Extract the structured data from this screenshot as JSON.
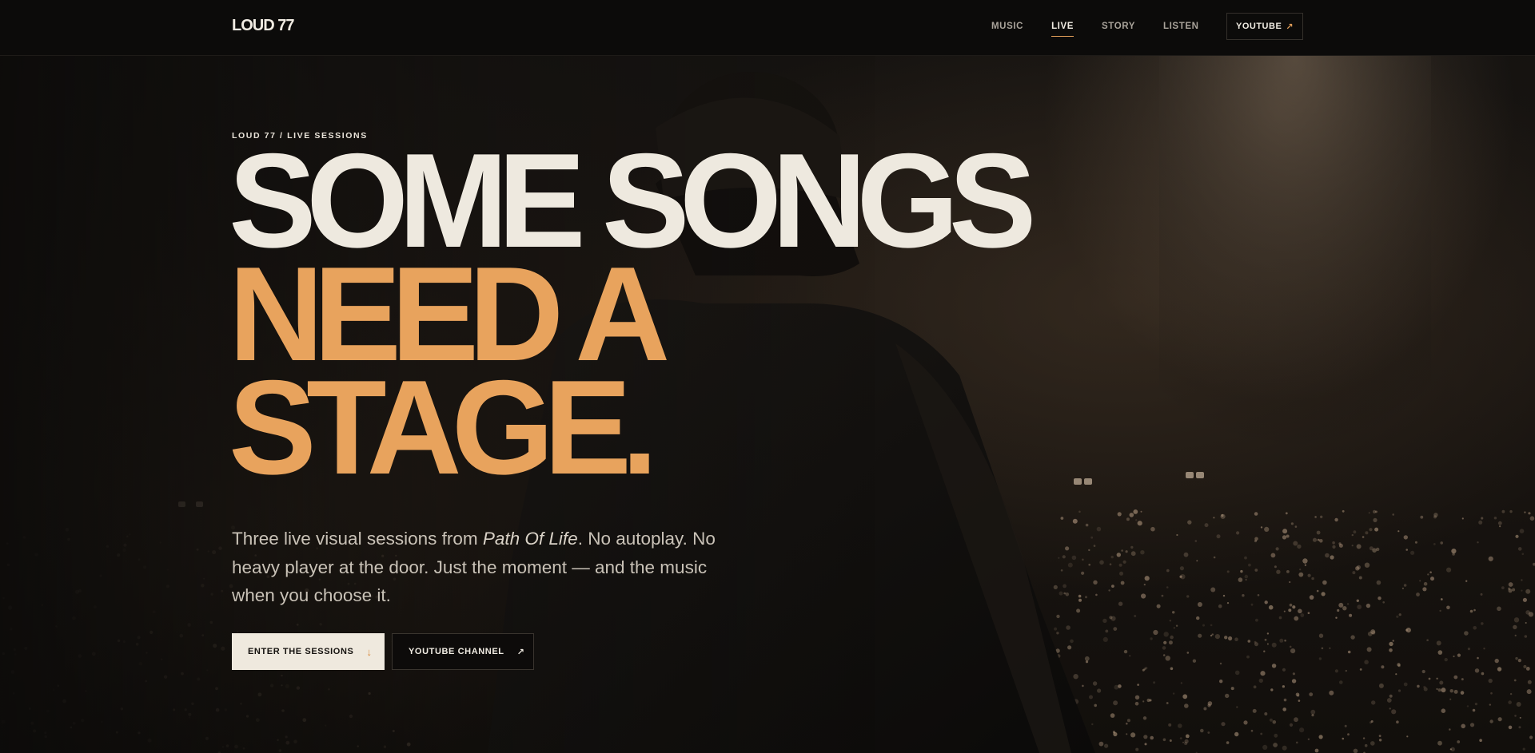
{
  "nav": {
    "logo": "LOUD 77",
    "links": [
      {
        "label": "MUSIC",
        "active": false
      },
      {
        "label": "LIVE",
        "active": true
      },
      {
        "label": "STORY",
        "active": false
      },
      {
        "label": "LISTEN",
        "active": false
      }
    ],
    "youtube_label": "YOUTUBE",
    "youtube_icon": "arrow-up-right-icon"
  },
  "hero": {
    "eyebrow": "LOUD 77 / LIVE SESSIONS",
    "headline": {
      "line1": "SOME SONGS",
      "line2": "NEED A",
      "line3": "STAGE."
    },
    "lede": {
      "before": "Three live visual sessions from ",
      "album": "Path Of Life",
      "after": ". No autoplay. No heavy player at the door. Just the moment — and the music when you choose it."
    },
    "primary_button": {
      "label": "ENTER THE SESSIONS",
      "icon": "arrow-down-icon"
    },
    "secondary_button": {
      "label": "YOUTUBE CHANNEL",
      "icon": "arrow-up-right-icon"
    }
  },
  "colors": {
    "background": "#0e0c0a",
    "headline_light": "#eee9df",
    "headline_accent": "#e8a35d",
    "accent": "#e39f5a"
  }
}
